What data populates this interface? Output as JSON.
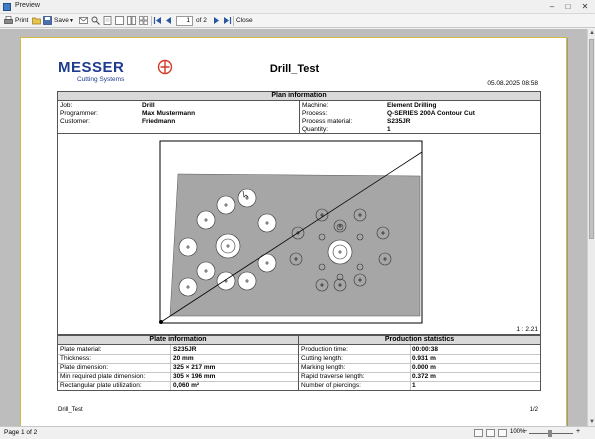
{
  "window": {
    "title": "Preview"
  },
  "toolbar": {
    "print_label": "Print",
    "save_label": "Save",
    "page_current": "1",
    "page_of": "of 2",
    "close_label": "Close"
  },
  "document": {
    "logo_brand": "MESSER",
    "logo_sub": "Cutting Systems",
    "title": "Drill_Test",
    "date": "05.08.2025 08:58",
    "plan_info": {
      "header": "Plan information",
      "job_label": "Job:",
      "job_value": "Drill",
      "programmer_label": "Programmer:",
      "programmer_value": "Max Mustermann",
      "customer_label": "Customer:",
      "customer_value": "Friedmann",
      "machine_label": "Machine:",
      "machine_value": "Element Drilling",
      "process_label": "Process:",
      "process_value": "Q-SERIES 200A Contour Cut",
      "material_label": "Process material:",
      "material_value": "S235JR",
      "quantity_label": "Quantity:",
      "quantity_value": "1"
    },
    "scale": "1 : 2.21",
    "plate_info": {
      "header": "Plate information",
      "rows": [
        {
          "label": "Plate material:",
          "value": "S235JR"
        },
        {
          "label": "Thickness:",
          "value": "20 mm"
        },
        {
          "label": "Plate dimension:",
          "value": "325 × 217 mm"
        },
        {
          "label": "Min required plate dimension:",
          "value": "305 × 196 mm"
        },
        {
          "label": "Rectangular plate utilization:",
          "value": "0,060 m²"
        }
      ]
    },
    "production_stats": {
      "header": "Production statistics",
      "rows": [
        {
          "label": "Production time:",
          "value": "00:00:38"
        },
        {
          "label": "Cutting length:",
          "value": "0.931 m"
        },
        {
          "label": "Marking length:",
          "value": "0.000 m"
        },
        {
          "label": "Rapid traverse length:",
          "value": "0.372 m"
        },
        {
          "label": "Number of piercings:",
          "value": "1"
        }
      ]
    },
    "footer_left": "Drill_Test",
    "footer_right": "1/2"
  },
  "statusbar": {
    "text": "Page 1 of 2",
    "zoom": "100%"
  },
  "colors": {
    "plate_fill": "#a6a6a6",
    "header_fill": "#d9d9d9",
    "logo_blue": "#1e3d8f",
    "logo_red": "#d23a2a",
    "page_border": "#d4b84a"
  }
}
